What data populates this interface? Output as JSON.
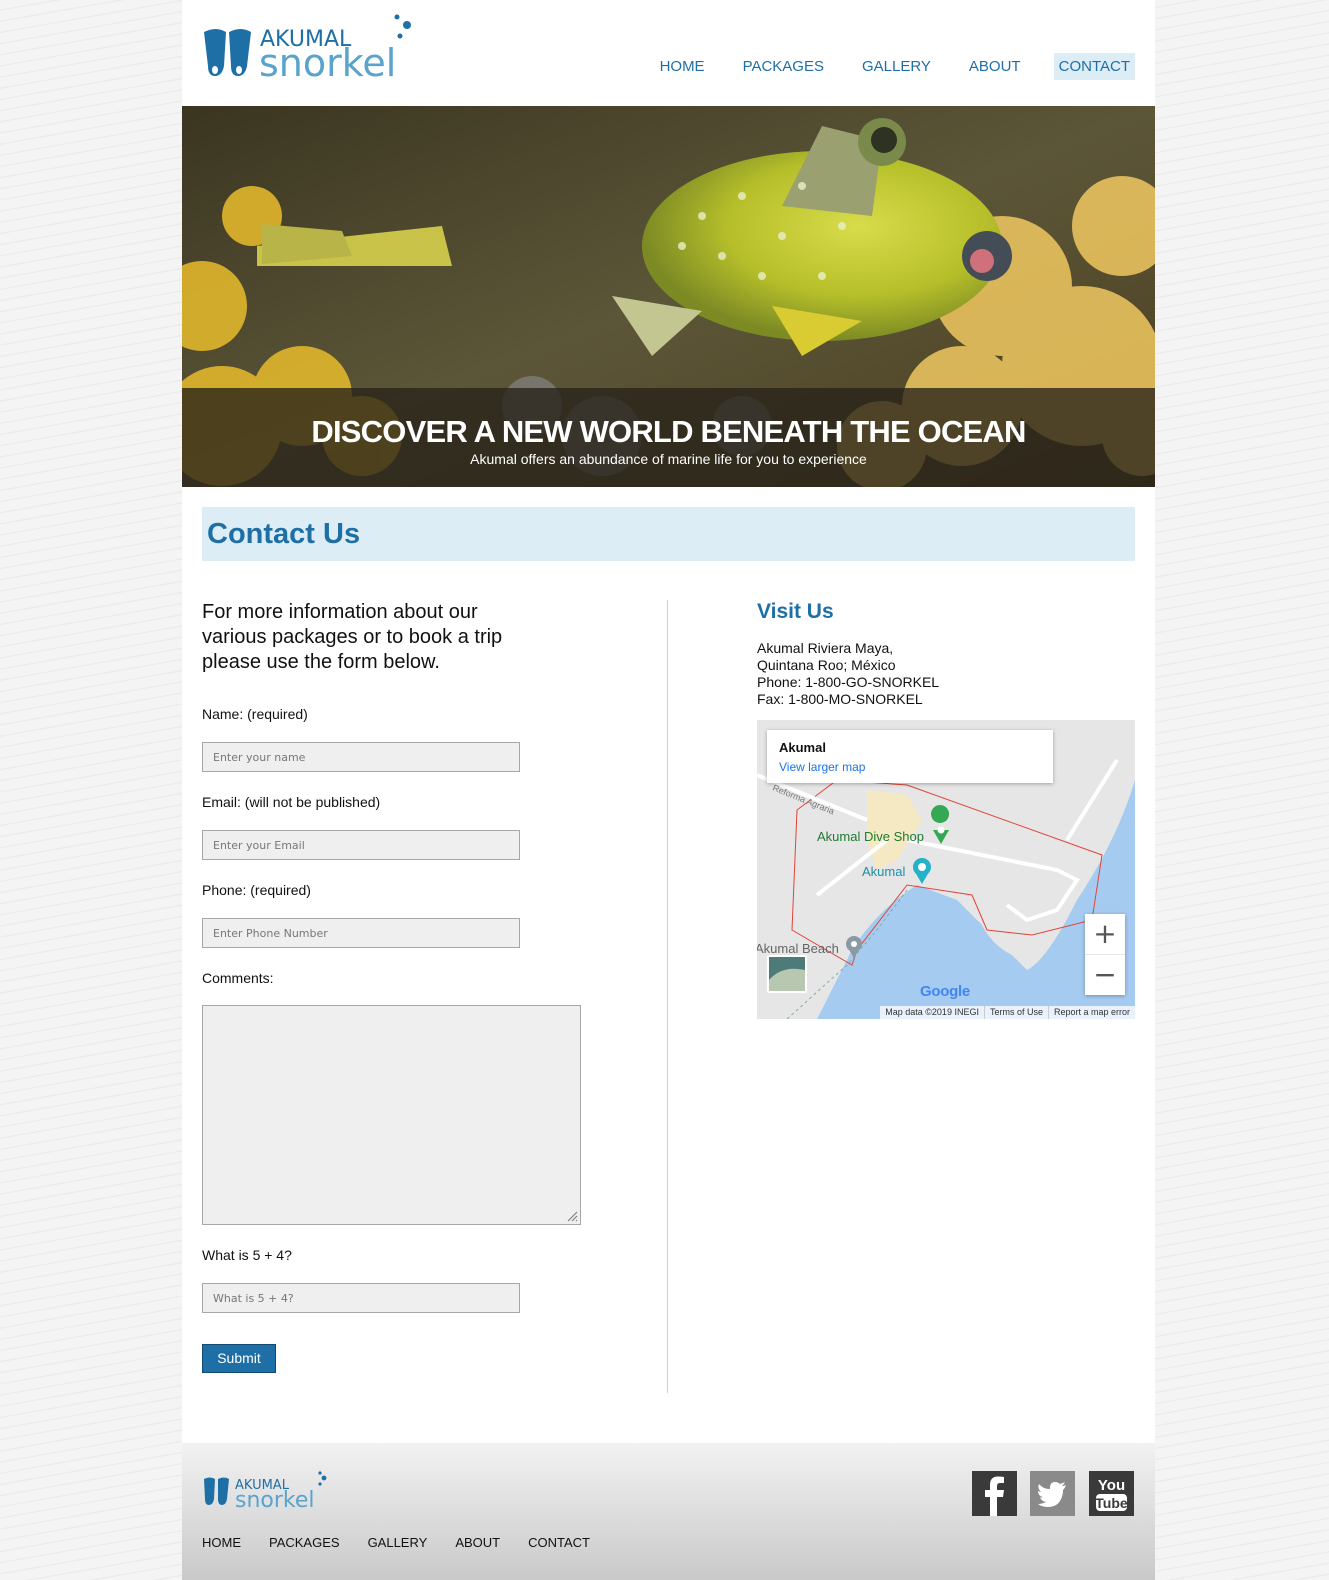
{
  "brand": {
    "line1": "AKUMAL",
    "line2": "snorkel"
  },
  "nav": [
    {
      "label": "HOME"
    },
    {
      "label": "PACKAGES"
    },
    {
      "label": "GALLERY"
    },
    {
      "label": "ABOUT"
    },
    {
      "label": "CONTACT",
      "active": true
    }
  ],
  "hero": {
    "title": "DISCOVER A NEW WORLD BENEATH THE OCEAN",
    "subtitle": "Akumal offers an abundance of marine life for you to experience"
  },
  "contact": {
    "heading": "Contact Us",
    "intro": "For more information about our various packages or to book a trip please use the form below.",
    "form": {
      "name_label": "Name: (required)",
      "name_placeholder": "Enter your name",
      "email_label": "Email: (will not be published)",
      "email_placeholder": "Enter your Email",
      "phone_label": "Phone: (required)",
      "phone_placeholder": "Enter Phone Number",
      "comments_label": "Comments:",
      "captcha_label": "What is 5 + 4?",
      "captcha_placeholder": "What is 5 + 4?",
      "submit_label": "Submit"
    }
  },
  "visit": {
    "heading": "Visit Us",
    "address_line1": "Akumal Riviera Maya,",
    "address_line2": "Quintana Roo; México",
    "phone": "Phone: 1-800-GO-SNORKEL",
    "fax": "Fax: 1-800-MO-SNORKEL"
  },
  "map": {
    "place_title": "Akumal",
    "larger_map_link": "View larger map",
    "road_label": "Reforma Agraria",
    "poi_dive_shop": "Akumal Dive Shop",
    "poi_akumal": "Akumal",
    "poi_beach": "Akumal Beach",
    "zoom_in": "+",
    "zoom_out": "−",
    "logo": "Google",
    "footer": [
      "Map data ©2019 INEGI",
      "Terms of Use",
      "Report a map error"
    ]
  },
  "footer": {
    "nav": [
      "HOME",
      "PACKAGES",
      "GALLERY",
      "ABOUT",
      "CONTACT"
    ],
    "social": {
      "youtube_line1": "You",
      "youtube_line2": "Tube"
    }
  },
  "colors": {
    "brand_blue": "#1e6fa6",
    "light_blue": "#dcedf6",
    "logo_light_blue": "#5aa3cc"
  }
}
